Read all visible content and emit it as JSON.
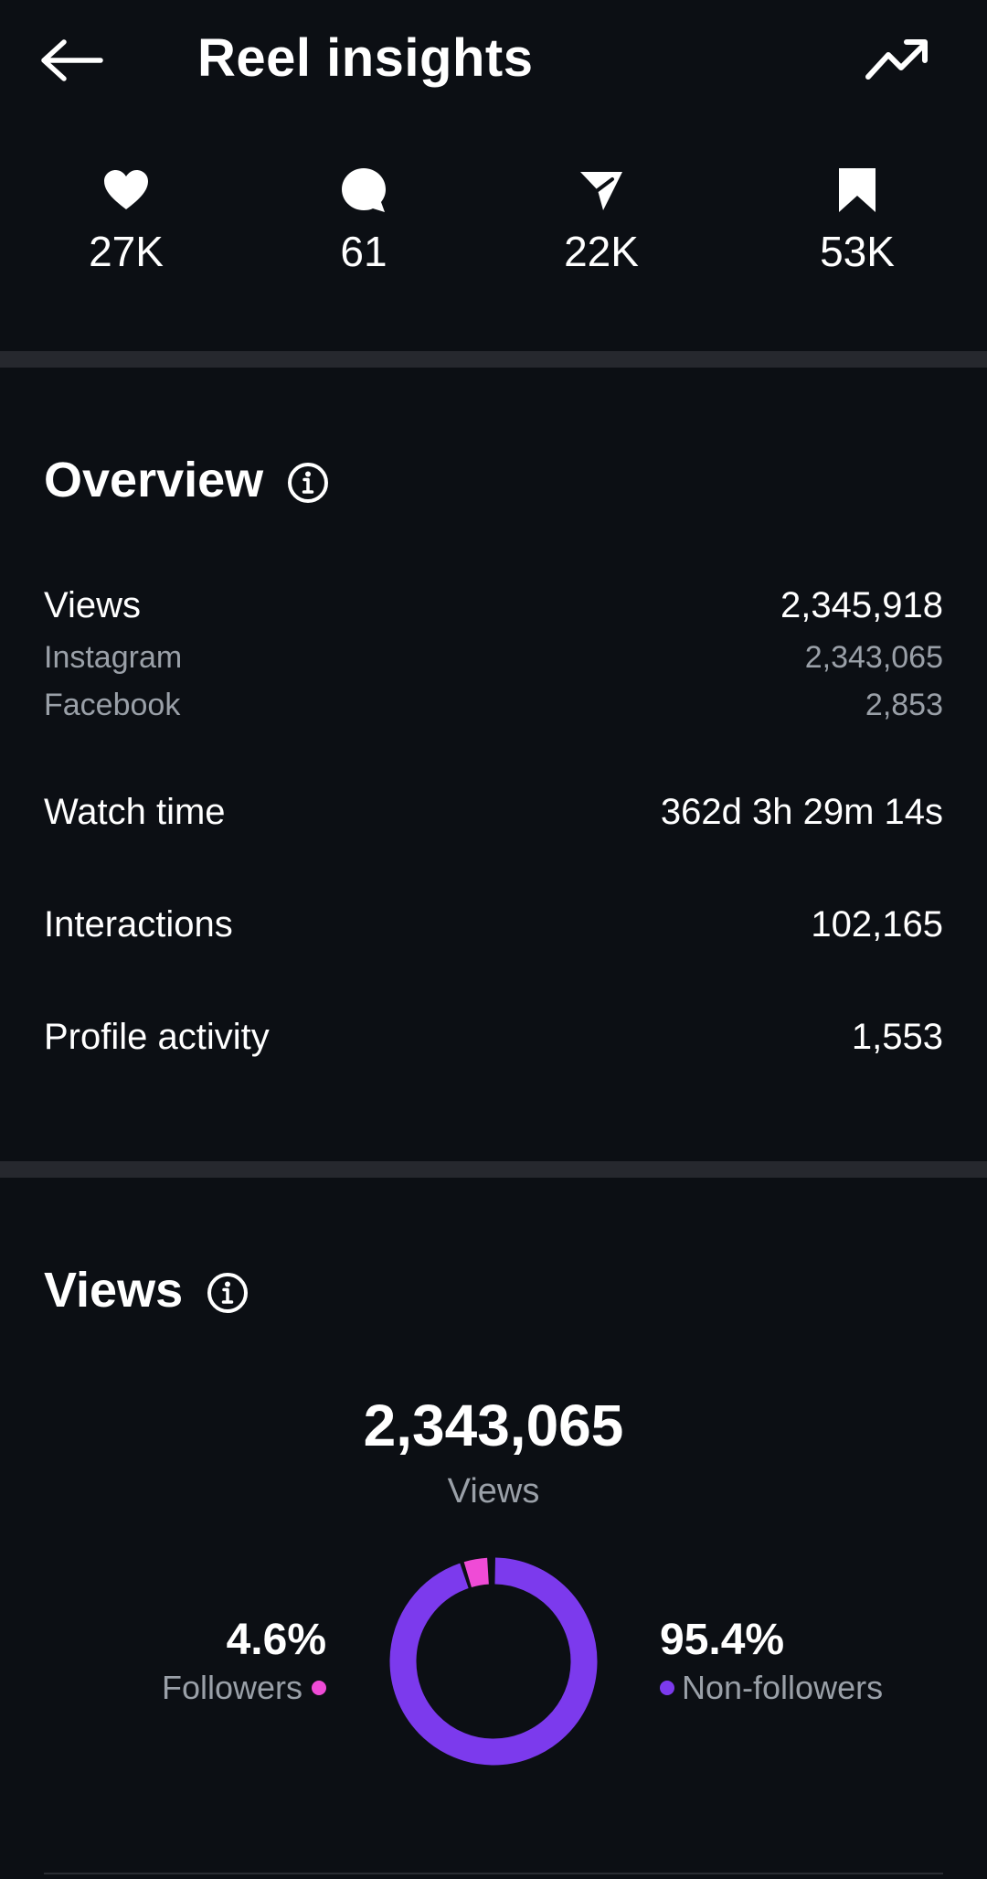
{
  "header": {
    "title": "Reel insights",
    "back_icon": "arrow-left-icon",
    "trend_icon": "trending-up-icon"
  },
  "stats": [
    {
      "icon": "heart-icon",
      "value": "27K"
    },
    {
      "icon": "comment-icon",
      "value": "61"
    },
    {
      "icon": "share-icon",
      "value": "22K"
    },
    {
      "icon": "bookmark-icon",
      "value": "53K"
    }
  ],
  "overview": {
    "title": "Overview",
    "views_label": "Views",
    "views_value": "2,345,918",
    "instagram_label": "Instagram",
    "instagram_value": "2,343,065",
    "facebook_label": "Facebook",
    "facebook_value": "2,853",
    "watch_time_label": "Watch time",
    "watch_time_value": "362d 3h 29m 14s",
    "interactions_label": "Interactions",
    "interactions_value": "102,165",
    "profile_activity_label": "Profile activity",
    "profile_activity_value": "1,553"
  },
  "views_section": {
    "title": "Views",
    "total": "2,343,065",
    "total_label": "Views",
    "followers_pct": "4.6%",
    "followers_label": "Followers",
    "followers_fraction": 0.046,
    "non_followers_pct": "95.4%",
    "non_followers_label": "Non-followers",
    "non_followers_fraction": 0.954
  },
  "colors": {
    "background": "#0c0f14",
    "divider": "#26282e",
    "muted_text": "#9aa0a8",
    "followers": "#ef4bd6",
    "non_followers": "#7c3aed"
  }
}
